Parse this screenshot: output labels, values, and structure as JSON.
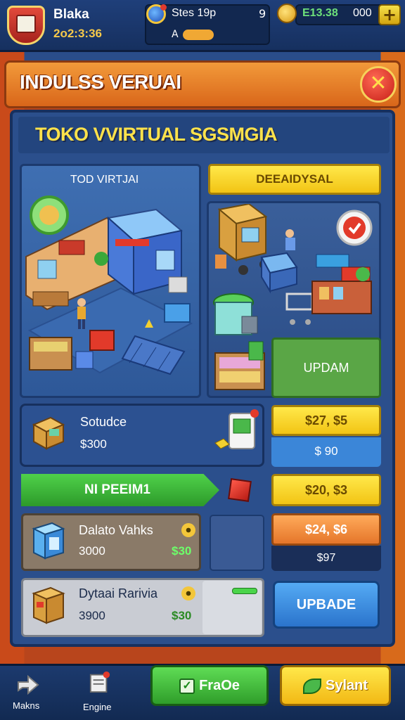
{
  "player": {
    "name": "Blaka",
    "code": "2o2:3:36"
  },
  "stats": {
    "name": "Stes 19p",
    "value": "9",
    "sub_label": "A",
    "sub_pill": ""
  },
  "currency": {
    "amount": "E13.38",
    "secondary": "000",
    "plus_label": "+"
  },
  "banner": {
    "title": "INDULSS VERUAI",
    "close_label": "✕"
  },
  "store": {
    "title": "TOKO VVIRTUAL SGSMGIA",
    "left_scene_label": "TOD VIRTJAI",
    "right_header": "DEEAIDYSAL",
    "green_tile": "UPDAM"
  },
  "rows": [
    {
      "name": "Sotudce",
      "price": "$300",
      "tag": "$27, $5",
      "sub": "$ 90"
    },
    {
      "name": "NI PEEIM1",
      "tag": "$20, $3"
    },
    {
      "name": "Dalato Vahks",
      "price": "3000",
      "bonus": "$30",
      "tag": "$24, $6",
      "sub": "$97"
    },
    {
      "name": "Dytaai Rarivia",
      "price": "3900",
      "bonus": "$30",
      "button": "UPBADE"
    }
  ],
  "bottom_nav": {
    "left_label": "Makns",
    "mid_label": "Engine",
    "green_button": "FraOe",
    "yellow_button": "Sylant"
  },
  "colors": {
    "accent_yellow": "#ffe84a",
    "accent_green": "#4fd14a",
    "panel_blue": "#2b4f8c",
    "banner_orange": "#e97a2a"
  }
}
